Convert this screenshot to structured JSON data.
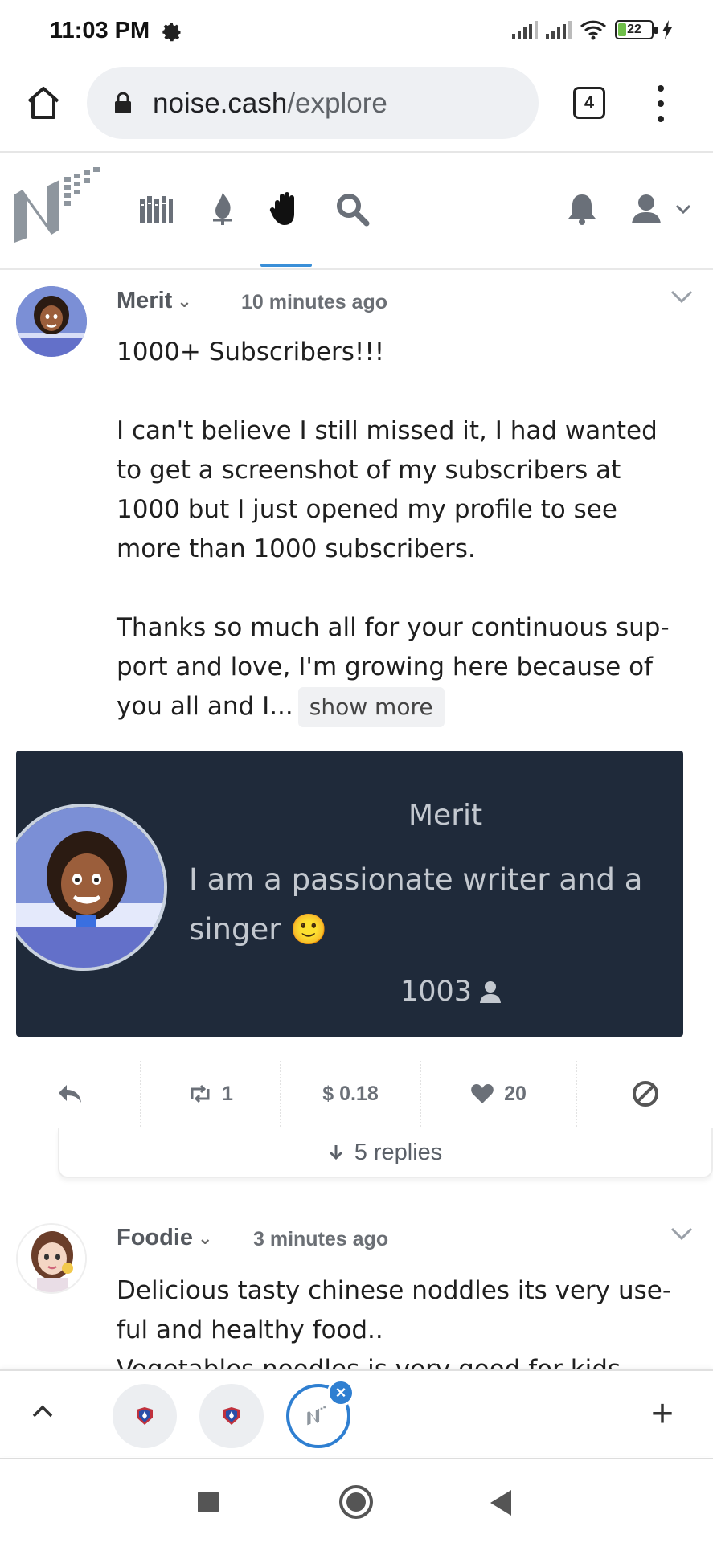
{
  "status_bar": {
    "time": "11:03 PM",
    "battery": "22",
    "icons": [
      "gear-icon",
      "signal-icon",
      "signal-icon",
      "wifi-icon",
      "battery-icon",
      "charging-icon"
    ]
  },
  "browser": {
    "url_domain": "noise.cash",
    "url_path": "/explore",
    "tab_count": "4"
  },
  "site_nav": {
    "items": [
      "library-icon",
      "fire-icon",
      "hand-icon",
      "search-icon",
      "bell-icon",
      "user-icon"
    ],
    "active_index": 2
  },
  "post1": {
    "author": "Merit",
    "time": "10 minutes ago",
    "title": "1000+ Subscribers!!!",
    "paragraph1": "I can't believe I still missed it, I had wanted to get a screenshot of my subscribers at 1000 but I just opened my profile to see more than 1000 subscribers.",
    "paragraph2": "Thanks so much all for your continuous sup-port and love, I'm growing here because of you all and I...",
    "show_more": "show more",
    "card": {
      "name": "Merit",
      "bio": "I am a passionate writer and a singer",
      "emoji": "🙂",
      "subscribers": "1003"
    },
    "actions": {
      "recasts": "1",
      "tips": "$ 0.18",
      "likes": "20"
    },
    "replies": "5 replies"
  },
  "post2": {
    "author": "Foodie",
    "time": "3 minutes ago",
    "text": "Delicious tasty chinese noddles its very use-ful and healthy food..",
    "text_cut": "Vegetables noodles is very good for kids"
  },
  "tab_switcher": {
    "plus": "+",
    "close": "×"
  },
  "colors": {
    "accent": "#3a8fd8",
    "card_bg": "#1f2a3a",
    "text_muted": "#6b7078"
  }
}
